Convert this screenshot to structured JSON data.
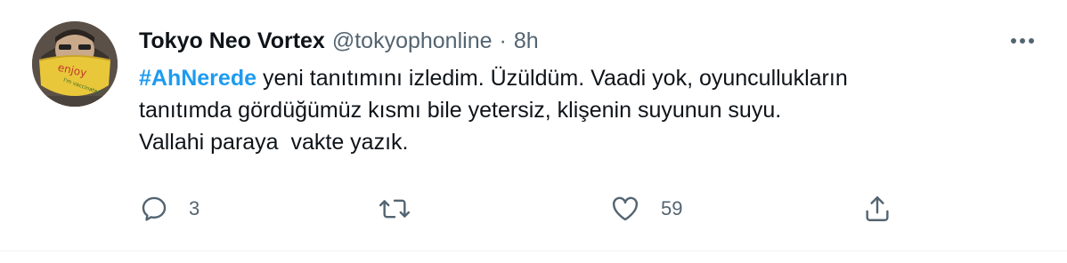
{
  "tweet": {
    "display_name": "Tokyo Neo Vortex",
    "handle": "@tokyophonline",
    "separator": "·",
    "time": "8h",
    "hashtag": "#AhNerede",
    "line1_rest": " yeni tanıtımını izledim. Üzüldüm. Vaadi yok, oyuncullukların",
    "line2": "tanıtımda gördüğümüz kısmı bile yetersiz, klişenin suyunun suyu.",
    "line3": "Vallahi paraya  vakte yazık.",
    "avatar_mask_text": "enjoy",
    "avatar_mask_subtext": "I'm vaccinated"
  },
  "actions": {
    "reply_count": "3",
    "retweet_count": "",
    "like_count": "59"
  },
  "icons": {
    "more": "more-horizontal-icon",
    "reply": "reply-icon",
    "retweet": "retweet-icon",
    "like": "heart-icon",
    "share": "share-icon"
  },
  "colors": {
    "link": "#1d9bf0",
    "text": "#0f1419",
    "secondary": "#536471",
    "mask": "#e8c73a"
  }
}
